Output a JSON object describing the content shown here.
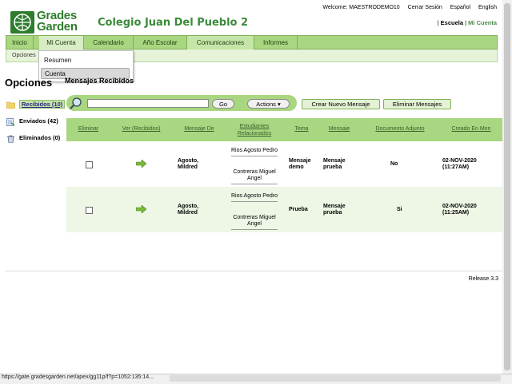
{
  "header": {
    "logo_line1": "Grades",
    "logo_line2": "Garden",
    "school": "Colegio Juan Del Pueblo 2",
    "greeting": "Welcome: MAESTRODEMO10",
    "logout": "Cerrar Sesión",
    "lang_es": "Español",
    "lang_en": "English",
    "escuela": "Escuela",
    "mi_cuenta": "Mi Cuenta"
  },
  "nav": {
    "tabs": [
      "Inicio",
      "Mi Cuenta",
      "Calendario",
      "Año Escolar",
      "Comunicaciones",
      "Informes"
    ],
    "sub": "Opciones"
  },
  "dropdown": [
    "Resumen",
    "Cuenta"
  ],
  "sidebar": {
    "title": "Opciones",
    "items": [
      "Recibidos (10)",
      "Enviados (42)",
      "Eliminados (0)"
    ]
  },
  "main": {
    "title": "Mensajes Recibidos",
    "search_value": "",
    "go": "Go",
    "actions": "Actions",
    "new_msg": "Crear Nuevo Mensaje",
    "delete_msgs": "Eliminar Mensajes"
  },
  "table": {
    "headers": [
      "Eliminar",
      "Ver (Recibidos)",
      "Mensaje De",
      "Estudiantes Relacionados",
      "Tema",
      "Mensaje",
      "Documento Adjunto",
      "Creado En Men"
    ],
    "rows": [
      {
        "from": "Agosto, Mildred",
        "students": [
          "Rios Agosto Pedro",
          "Contreras Miguel Angel"
        ],
        "tema": "Mensaje demo",
        "mensaje": "Mensaje prueba",
        "adjunto": "No",
        "creado": "02-NOV-2020 (11:27AM)"
      },
      {
        "from": "Agosto, Mildred",
        "students": [
          "Rios Agosto Pedro",
          "Contreras Miguel Angel"
        ],
        "tema": "Prueba",
        "mensaje": "Mensaje prueba",
        "adjunto": "Si",
        "creado": "02-NOV-2020 (11:25AM)"
      }
    ]
  },
  "footer": {
    "release": "Release 3.3",
    "status_url": "https://gate.gradesgarden.net/apex/gg11p/f?p=1052:135:14..."
  },
  "colors": {
    "accent": "#a9d680",
    "brand": "#2e7d2e"
  }
}
